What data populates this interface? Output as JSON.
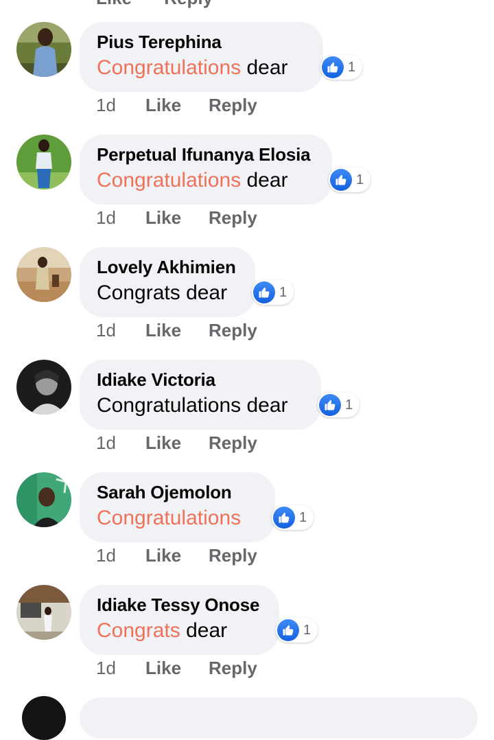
{
  "top_partial": {
    "like": "Like",
    "reply": "Reply"
  },
  "comments": [
    {
      "author": "Pius Terephina",
      "highlight": "Congratulations",
      "text": " dear",
      "reactions": "1",
      "time": "1d",
      "like": "Like",
      "reply": "Reply"
    },
    {
      "author": "Perpetual Ifunanya Elosia",
      "highlight": "Congratulations",
      "text": " dear",
      "reactions": "1",
      "time": "1d",
      "like": "Like",
      "reply": "Reply"
    },
    {
      "author": "Lovely Akhimien",
      "highlight": "",
      "text": "Congrats dear",
      "reactions": "1",
      "time": "1d",
      "like": "Like",
      "reply": "Reply"
    },
    {
      "author": "Idiake Victoria",
      "highlight": "",
      "text": "Congratulations dear",
      "reactions": "1",
      "time": "1d",
      "like": "Like",
      "reply": "Reply"
    },
    {
      "author": "Sarah Ojemolon",
      "highlight": "Congratulations",
      "text": "",
      "reactions": "1",
      "time": "1d",
      "like": "Like",
      "reply": "Reply"
    },
    {
      "author": "Idiake Tessy Onose",
      "highlight": "Congrats",
      "text": " dear",
      "reactions": "1",
      "time": "1d",
      "like": "Like",
      "reply": "Reply"
    }
  ],
  "colors": {
    "highlight": "#ee7158",
    "bubble": "#f0f2f5",
    "like_blue": "#1877f2",
    "meta_gray": "#65676b"
  },
  "icons": {
    "reaction": "thumbs-up-icon"
  }
}
